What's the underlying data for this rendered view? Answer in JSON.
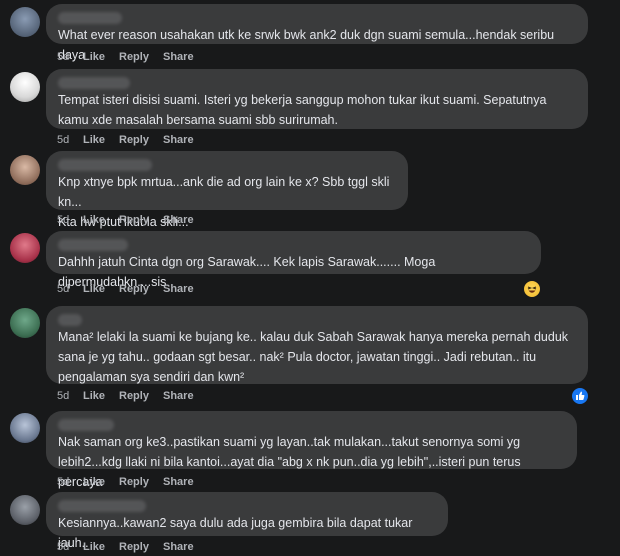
{
  "actions": {
    "like": "Like",
    "reply": "Reply",
    "share": "Share"
  },
  "comments": [
    {
      "time": "5d",
      "text": "What ever reason usahakan utk ke srwk bwk ank2 duk dgn suami semula...hendak seribu daya"
    },
    {
      "time": "5d",
      "text": "Tempat isteri disisi suami. Isteri yg bekerja sanggup mohon tukar ikut suami. Sepatutnya\nkamu xde masalah bersama suami sbb surirumah."
    },
    {
      "time": "5d",
      "text": "Knp xtnye bpk mrtua...ank die ad org lain ke x? Sbb tggl skli kn...\nKta hw ptut ikut la skli..."
    },
    {
      "time": "5d",
      "text": "Dahhh jatuh Cinta dgn org Sarawak.... Kek lapis Sarawak....... Moga dipermudahkn....sis"
    },
    {
      "time": "5d",
      "text": "Mana² lelaki la suami ke bujang ke.. kalau duk Sabah Sarawak hanya mereka pernah duduk\nsana je yg tahu.. godaan sgt besar.. nak² Pula doctor, jawatan tinggi.. Jadi rebutan.. itu\npengalaman sya sendiri dan kwn²"
    },
    {
      "time": "5d",
      "text": "Nak saman org ke3..pastikan suami yg layan..tak mulakan...takut senornya somi yg\nlebih2...kdg llaki ni bila kantoi...ayat dia \"abg x nk pun..dia yg lebih\",..isteri pun terus percaya"
    },
    {
      "time": "5d",
      "text": "Kesiannya..kawan2 saya dulu ada juga gembira bila dapat tukar jauh.."
    }
  ],
  "colors": {
    "background": "#18191a",
    "bubble": "#3a3b3c",
    "text": "#e4e6eb",
    "meta": "#b0b3b8"
  }
}
